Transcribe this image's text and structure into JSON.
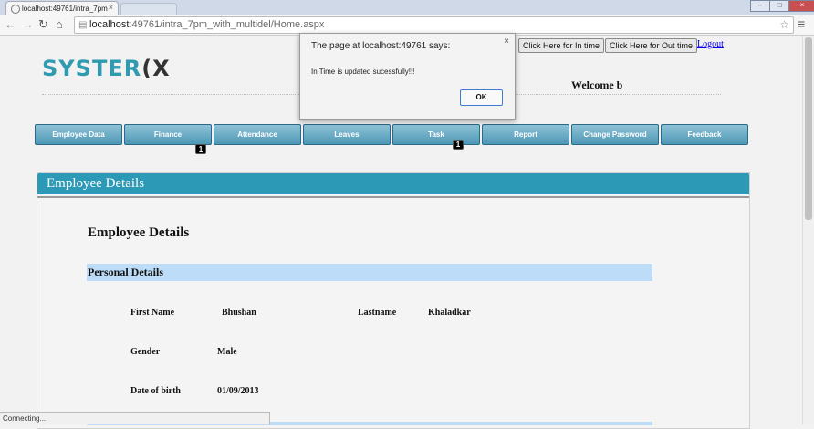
{
  "browser": {
    "tab_title": "localhost:49761/intra_7pm",
    "tab_close": "×",
    "second_tab_title": "",
    "window_controls": [
      "–",
      "□",
      "×"
    ],
    "back_icon": "←",
    "forward_icon": "→",
    "reload_icon": "↻",
    "home_icon": "⌂",
    "page_icon": "▤",
    "url_host": "localhost",
    "url_rest": ":49761/intra_7pm_with_multidel/Home.aspx",
    "star_icon": "☆",
    "menu_icon": "≡",
    "status_text": "Connecting..."
  },
  "header": {
    "logo_part1": "SYSTER",
    "logo_part2": "(X",
    "welcome_text": "Welcome b",
    "in_time_button": "Click Here for In time",
    "out_time_button": "Click Here for Out time",
    "logout_link": "Logout"
  },
  "nav": {
    "items": [
      "Employee  Data",
      "Finance",
      "Attendance",
      "Leaves",
      "Task",
      "Report",
      "Change Password",
      "Feedback"
    ],
    "finance_badge": "1",
    "task_badge": "1"
  },
  "panel": {
    "header_title": "Employee Details",
    "heading": "Employee Details",
    "section_title": "Personal Details",
    "fields": {
      "first_name_label": "First Name",
      "first_name_value": "Bhushan",
      "last_name_label": "Lastname",
      "last_name_value": "Khaladkar",
      "gender_label": "Gender",
      "gender_value": "Male",
      "dob_label": "Date of birth",
      "dob_value": "01/09/2013"
    }
  },
  "dialog": {
    "title": "The page at localhost:49761 says:",
    "close": "×",
    "message": "In Time is updated sucessfully!!!",
    "ok_label": "OK"
  },
  "colors": {
    "accent": "#2c9ab7",
    "nav_gradient_top": "#8ec2d6",
    "nav_gradient_bottom": "#4d98b6",
    "section_bar": "#bcdcf7"
  }
}
